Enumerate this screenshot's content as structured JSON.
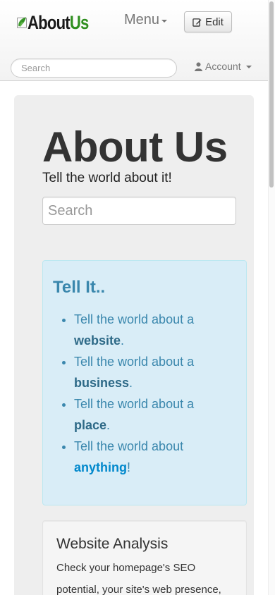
{
  "navbar": {
    "logo": {
      "about": "About",
      "us": "Us"
    },
    "menu_label": "Menu",
    "edit_label": "Edit",
    "search_placeholder": "Search",
    "account_label": "Account"
  },
  "hero": {
    "title": "About Us",
    "subtitle": "Tell the world about it!",
    "search_placeholder": "Search"
  },
  "info_box": {
    "heading": "Tell It..",
    "items": [
      {
        "prefix": "Tell the world about a ",
        "strong": "website",
        "suffix": "."
      },
      {
        "prefix": "Tell the world about a ",
        "strong": "business",
        "suffix": "."
      },
      {
        "prefix": "Tell the world about a ",
        "strong": "place",
        "suffix": "."
      },
      {
        "prefix": "Tell the world about ",
        "link": "anything",
        "suffix": "!"
      }
    ]
  },
  "analysis_card": {
    "heading": "Website Analysis",
    "text": "Check your homepage's SEO potential, your site's web presence,"
  },
  "colors": {
    "brand_green": "#2f8f1f",
    "info_bg": "#d9edf7",
    "info_text": "#3a87ad",
    "link": "#0088cc"
  },
  "icons": [
    "leaf-logo-icon",
    "pencil-edit-icon",
    "user-icon",
    "caret-down-icon"
  ]
}
